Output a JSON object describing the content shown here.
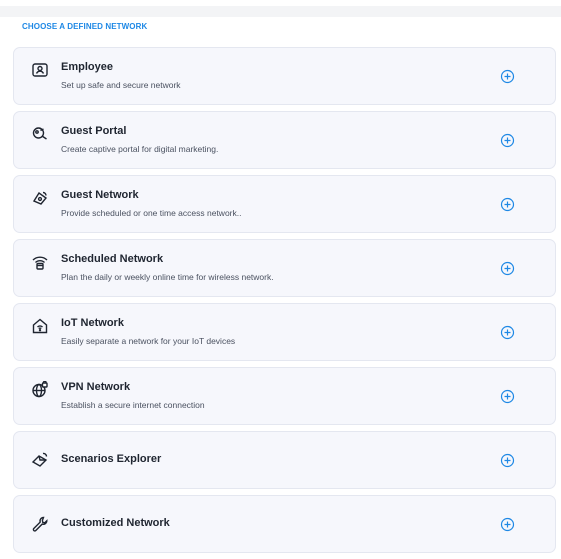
{
  "section_title": "CHOOSE A DEFINED NETWORK",
  "accent_color": "#1e88e5",
  "cards": [
    {
      "icon": "badge-icon",
      "title": "Employee",
      "desc": "Set up safe and secure network"
    },
    {
      "icon": "guest-portal-icon",
      "title": "Guest Portal",
      "desc": "Create captive portal for digital marketing."
    },
    {
      "icon": "guest-network-icon",
      "title": "Guest Network",
      "desc": "Provide scheduled or one time access network.."
    },
    {
      "icon": "scheduled-network-icon",
      "title": "Scheduled Network",
      "desc": "Plan the daily or weekly online time for wireless network."
    },
    {
      "icon": "iot-home-icon",
      "title": "IoT Network",
      "desc": "Easily separate a network for your IoT devices"
    },
    {
      "icon": "vpn-globe-icon",
      "title": "VPN Network",
      "desc": "Establish a secure internet connection"
    },
    {
      "icon": "scenarios-icon",
      "title": "Scenarios Explorer",
      "desc": ""
    },
    {
      "icon": "wrench-icon",
      "title": "Customized Network",
      "desc": ""
    }
  ]
}
